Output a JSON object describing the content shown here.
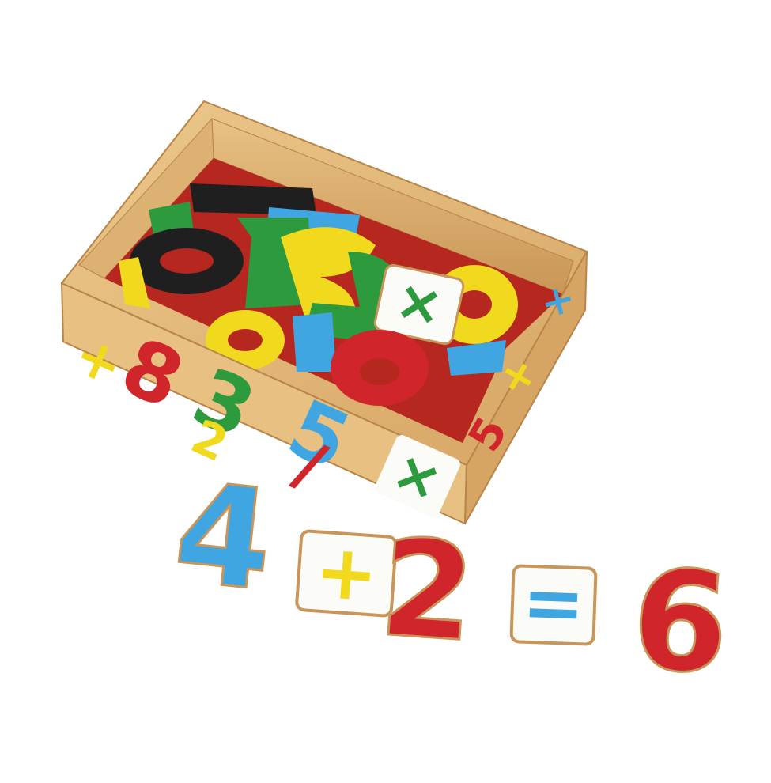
{
  "scene": {
    "subject": "wooden box of magnetic number pieces",
    "equation": {
      "tokens": [
        "4",
        "+",
        "2",
        "=",
        "6"
      ]
    },
    "box_front_symbols": [
      "+",
      "8",
      "3",
      "5",
      "2",
      "/",
      "×"
    ],
    "box_side_symbols": [
      "+",
      "5",
      "×"
    ],
    "inside_pieces": [
      "1",
      "0",
      "7",
      "5",
      "3",
      "9",
      "×",
      "6",
      "0",
      "2"
    ]
  },
  "colors": {
    "background": "#ffffff",
    "wood": "#e2b97a",
    "wood_dark": "#c8955a",
    "felt": "#b5271f",
    "red": "#d0262b",
    "blue": "#3fa6e2",
    "green": "#2e9a3e",
    "yellow": "#f1d91e",
    "black": "#1f1f1f",
    "tile": "#fbfbf8"
  }
}
